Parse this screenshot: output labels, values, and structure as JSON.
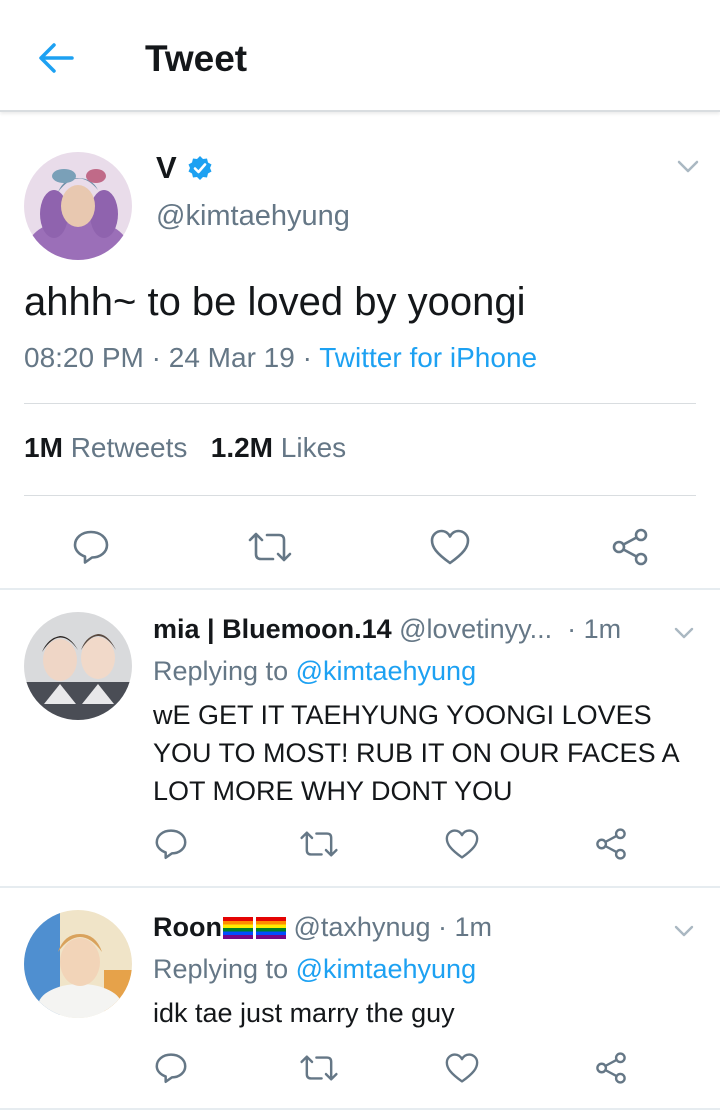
{
  "header": {
    "title": "Tweet"
  },
  "main_tweet": {
    "name": "V",
    "handle": "@kimtaehyung",
    "text": "ahhh~ to be loved by yoongi",
    "time": "08:20 PM",
    "sep1": " · ",
    "date": "24 Mar 19",
    "sep2": " · ",
    "source": "Twitter for iPhone",
    "retweets_count": "1M",
    "retweets_label": "Retweets",
    "likes_count": "1.2M",
    "likes_label": "Likes"
  },
  "replies": [
    {
      "name": "mia | Bluemoon.14",
      "handle": "@lovetinyy...",
      "time": "· 1m",
      "replying_prefix": "Replying to ",
      "replying_to": "@kimtaehyung",
      "text": "wE GET IT TAEHYUNG YOONGI LOVES YOU TO MOST! RUB IT ON OUR FACES A LOT MORE WHY DONT YOU"
    },
    {
      "name": "Roon",
      "handle": "@taxhynug",
      "time": "· 1m",
      "replying_prefix": "Replying to ",
      "replying_to": "@kimtaehyung",
      "text": "idk tae just marry the guy"
    }
  ],
  "colors": {
    "accent": "#1da1f2",
    "secondary_text": "#657786",
    "icon": "#657786"
  }
}
